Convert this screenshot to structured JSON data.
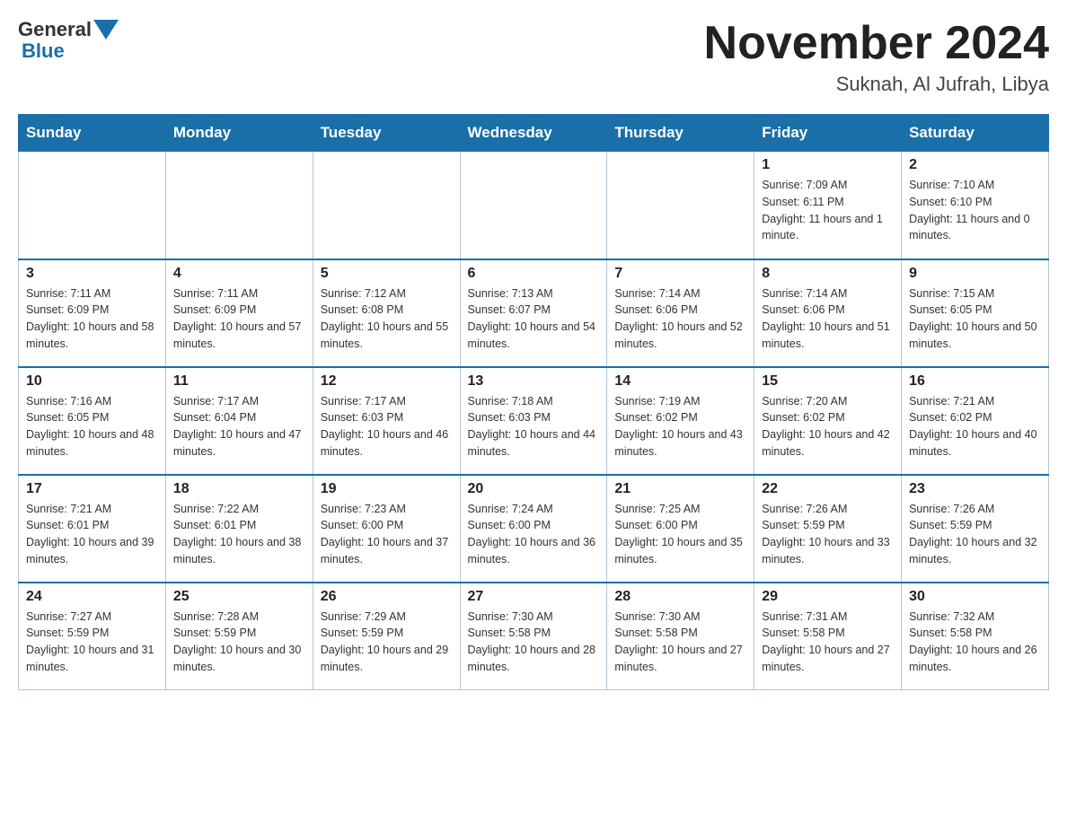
{
  "header": {
    "logo_general": "General",
    "logo_blue": "Blue",
    "title": "November 2024",
    "subtitle": "Suknah, Al Jufrah, Libya"
  },
  "days_of_week": [
    "Sunday",
    "Monday",
    "Tuesday",
    "Wednesday",
    "Thursday",
    "Friday",
    "Saturday"
  ],
  "weeks": [
    [
      {
        "day": "",
        "info": ""
      },
      {
        "day": "",
        "info": ""
      },
      {
        "day": "",
        "info": ""
      },
      {
        "day": "",
        "info": ""
      },
      {
        "day": "",
        "info": ""
      },
      {
        "day": "1",
        "info": "Sunrise: 7:09 AM\nSunset: 6:11 PM\nDaylight: 11 hours and 1 minute."
      },
      {
        "day": "2",
        "info": "Sunrise: 7:10 AM\nSunset: 6:10 PM\nDaylight: 11 hours and 0 minutes."
      }
    ],
    [
      {
        "day": "3",
        "info": "Sunrise: 7:11 AM\nSunset: 6:09 PM\nDaylight: 10 hours and 58 minutes."
      },
      {
        "day": "4",
        "info": "Sunrise: 7:11 AM\nSunset: 6:09 PM\nDaylight: 10 hours and 57 minutes."
      },
      {
        "day": "5",
        "info": "Sunrise: 7:12 AM\nSunset: 6:08 PM\nDaylight: 10 hours and 55 minutes."
      },
      {
        "day": "6",
        "info": "Sunrise: 7:13 AM\nSunset: 6:07 PM\nDaylight: 10 hours and 54 minutes."
      },
      {
        "day": "7",
        "info": "Sunrise: 7:14 AM\nSunset: 6:06 PM\nDaylight: 10 hours and 52 minutes."
      },
      {
        "day": "8",
        "info": "Sunrise: 7:14 AM\nSunset: 6:06 PM\nDaylight: 10 hours and 51 minutes."
      },
      {
        "day": "9",
        "info": "Sunrise: 7:15 AM\nSunset: 6:05 PM\nDaylight: 10 hours and 50 minutes."
      }
    ],
    [
      {
        "day": "10",
        "info": "Sunrise: 7:16 AM\nSunset: 6:05 PM\nDaylight: 10 hours and 48 minutes."
      },
      {
        "day": "11",
        "info": "Sunrise: 7:17 AM\nSunset: 6:04 PM\nDaylight: 10 hours and 47 minutes."
      },
      {
        "day": "12",
        "info": "Sunrise: 7:17 AM\nSunset: 6:03 PM\nDaylight: 10 hours and 46 minutes."
      },
      {
        "day": "13",
        "info": "Sunrise: 7:18 AM\nSunset: 6:03 PM\nDaylight: 10 hours and 44 minutes."
      },
      {
        "day": "14",
        "info": "Sunrise: 7:19 AM\nSunset: 6:02 PM\nDaylight: 10 hours and 43 minutes."
      },
      {
        "day": "15",
        "info": "Sunrise: 7:20 AM\nSunset: 6:02 PM\nDaylight: 10 hours and 42 minutes."
      },
      {
        "day": "16",
        "info": "Sunrise: 7:21 AM\nSunset: 6:02 PM\nDaylight: 10 hours and 40 minutes."
      }
    ],
    [
      {
        "day": "17",
        "info": "Sunrise: 7:21 AM\nSunset: 6:01 PM\nDaylight: 10 hours and 39 minutes."
      },
      {
        "day": "18",
        "info": "Sunrise: 7:22 AM\nSunset: 6:01 PM\nDaylight: 10 hours and 38 minutes."
      },
      {
        "day": "19",
        "info": "Sunrise: 7:23 AM\nSunset: 6:00 PM\nDaylight: 10 hours and 37 minutes."
      },
      {
        "day": "20",
        "info": "Sunrise: 7:24 AM\nSunset: 6:00 PM\nDaylight: 10 hours and 36 minutes."
      },
      {
        "day": "21",
        "info": "Sunrise: 7:25 AM\nSunset: 6:00 PM\nDaylight: 10 hours and 35 minutes."
      },
      {
        "day": "22",
        "info": "Sunrise: 7:26 AM\nSunset: 5:59 PM\nDaylight: 10 hours and 33 minutes."
      },
      {
        "day": "23",
        "info": "Sunrise: 7:26 AM\nSunset: 5:59 PM\nDaylight: 10 hours and 32 minutes."
      }
    ],
    [
      {
        "day": "24",
        "info": "Sunrise: 7:27 AM\nSunset: 5:59 PM\nDaylight: 10 hours and 31 minutes."
      },
      {
        "day": "25",
        "info": "Sunrise: 7:28 AM\nSunset: 5:59 PM\nDaylight: 10 hours and 30 minutes."
      },
      {
        "day": "26",
        "info": "Sunrise: 7:29 AM\nSunset: 5:59 PM\nDaylight: 10 hours and 29 minutes."
      },
      {
        "day": "27",
        "info": "Sunrise: 7:30 AM\nSunset: 5:58 PM\nDaylight: 10 hours and 28 minutes."
      },
      {
        "day": "28",
        "info": "Sunrise: 7:30 AM\nSunset: 5:58 PM\nDaylight: 10 hours and 27 minutes."
      },
      {
        "day": "29",
        "info": "Sunrise: 7:31 AM\nSunset: 5:58 PM\nDaylight: 10 hours and 27 minutes."
      },
      {
        "day": "30",
        "info": "Sunrise: 7:32 AM\nSunset: 5:58 PM\nDaylight: 10 hours and 26 minutes."
      }
    ]
  ]
}
